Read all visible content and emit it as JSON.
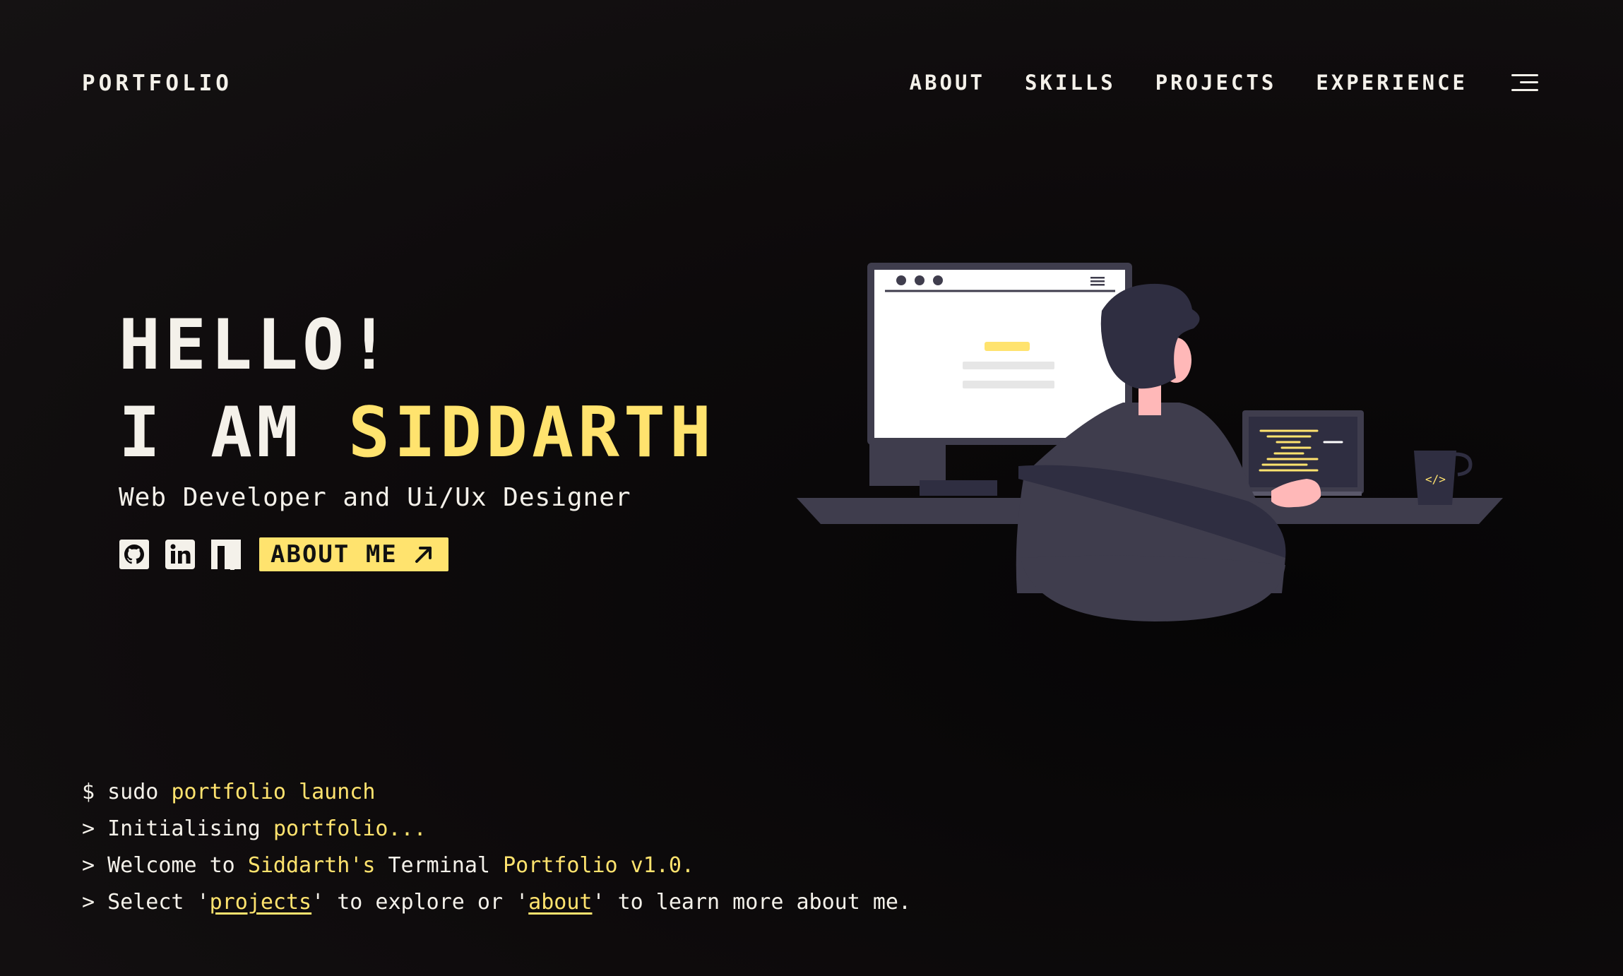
{
  "header": {
    "brand": "PORTFOLIO",
    "nav": [
      "ABOUT",
      "SKILLS",
      "PROJECTS",
      "EXPERIENCE"
    ],
    "menu_icon": "hamburger-menu-icon"
  },
  "hero": {
    "greeting": "HELLO!",
    "intro_prefix": "I AM ",
    "name": "SIDDARTH",
    "role": "Web Developer and Ui/Ux Designer",
    "socials": [
      "github-icon",
      "linkedin-icon",
      "notion-icon"
    ],
    "about_button": "ABOUT ME",
    "about_button_icon": "arrow-up-right-icon"
  },
  "terminal": {
    "line1": {
      "prompt": "$",
      "cmd": " sudo ",
      "arg": "portfolio launch"
    },
    "line2": {
      "prompt": ">",
      "text": " Initialising ",
      "accent": "portfolio..."
    },
    "line3": {
      "prompt": ">",
      "t1": " Welcome to ",
      "a1": "Siddarth's",
      "t2": " Terminal ",
      "a2": "Portfolio v1.0."
    },
    "line4": {
      "prompt": ">",
      "t1": " Select '",
      "link1": "projects",
      "t2": "' to explore or '",
      "link2": "about",
      "t3": "' to learn more about me."
    }
  },
  "colors": {
    "accent": "#ffe36e",
    "background": "#0e0b0c",
    "text": "#f4f1ea"
  }
}
